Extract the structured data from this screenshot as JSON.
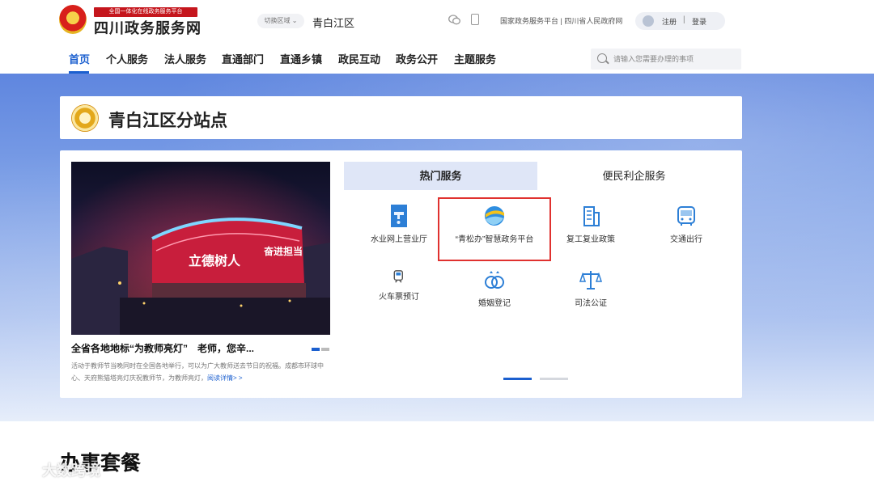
{
  "header": {
    "slogan": "全国一体化在线政务服务平台",
    "site_name": "四川政务服务网",
    "region_switch": "切换区域 ⌄",
    "region_name": "青白江区",
    "gov_links": "国家政务服务平台 | 四川省人民政府网",
    "register": "注册",
    "separator": "|",
    "login": "登录"
  },
  "nav": {
    "items": [
      {
        "label": "首页"
      },
      {
        "label": "个人服务"
      },
      {
        "label": "法人服务"
      },
      {
        "label": "直通部门"
      },
      {
        "label": "直通乡镇"
      },
      {
        "label": "政民互动"
      },
      {
        "label": "政务公开"
      },
      {
        "label": "主题服务"
      }
    ],
    "search_placeholder": "请输入您需要办理的事项"
  },
  "station": {
    "title": "青白江区分站点"
  },
  "news": {
    "photo_text_left": "立德树人",
    "photo_text_right": "奋进担当",
    "headline": "全省各地地标“为教师亮灯”　老师，您辛...",
    "body": "活动于教师节当晚同时在全国各地举行，可以为广大教师送去节日的祝福。成都市环球中心、天府熊猫塔亮灯庆祝教师节，为教师亮灯，",
    "more": "阅读详情> >"
  },
  "tabs": {
    "hot": "热门服务",
    "convenience": "便民利企服务"
  },
  "services": [
    {
      "label": "水业网上营业厅",
      "icon": "water-tap-icon"
    },
    {
      "label": "“青松办”智慧政务平台",
      "icon": "globe-logo-icon"
    },
    {
      "label": "复工复业政策",
      "icon": "building-icon"
    },
    {
      "label": "交通出行",
      "icon": "bus-icon"
    },
    {
      "label": "火车票预订",
      "icon": "train-icon"
    },
    {
      "label": "婚姻登记",
      "icon": "rings-icon"
    },
    {
      "label": "司法公证",
      "icon": "scales-icon"
    }
  ],
  "section_title": "办事套餐",
  "watermark": "大数跨境",
  "colors": {
    "brand_blue": "#1b5fcf",
    "highlight_red": "#e0312f",
    "slogan_red": "#c5161d"
  }
}
